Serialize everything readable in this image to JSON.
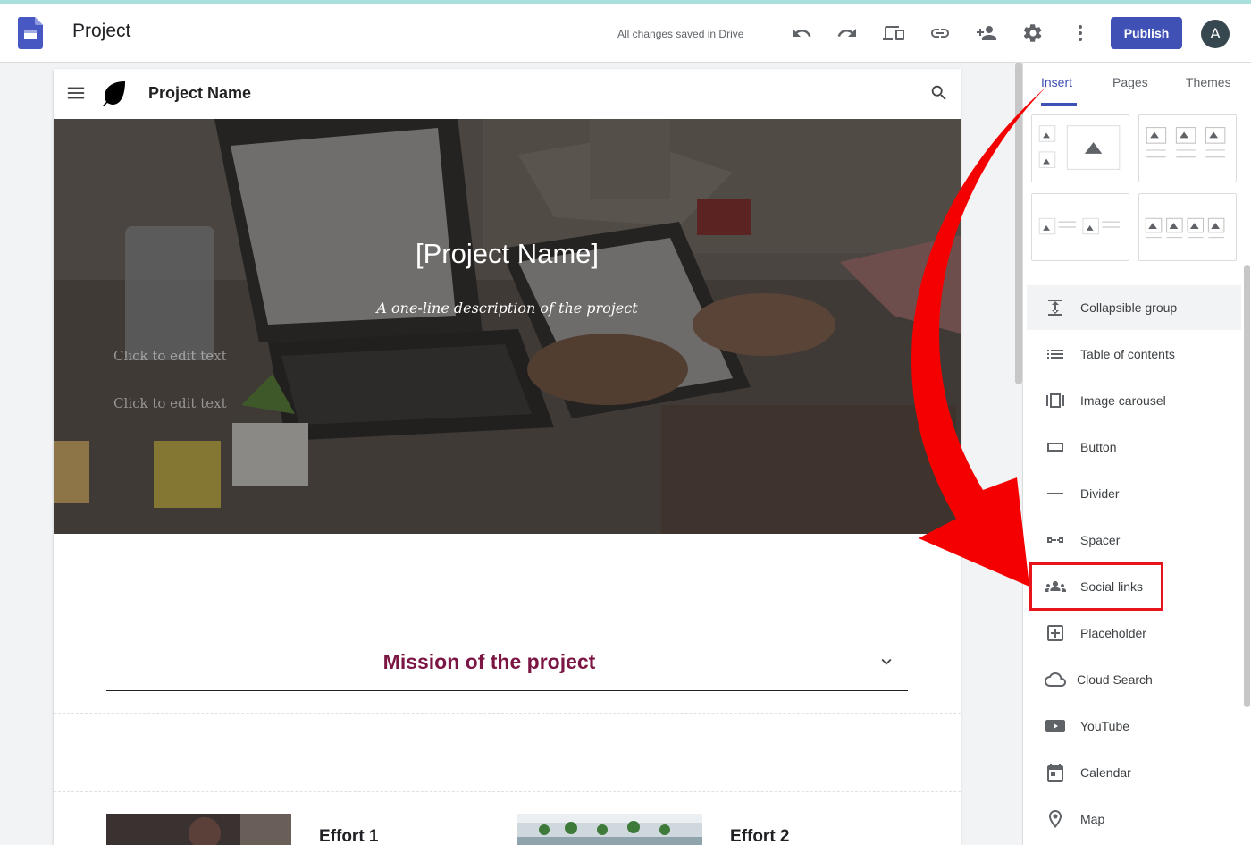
{
  "topbar": {
    "title": "Project",
    "save_status": "All changes saved in Drive",
    "publish_label": "Publish",
    "avatar_letter": "A",
    "icons": [
      "undo-icon",
      "redo-icon",
      "preview-devices-icon",
      "link-icon",
      "add-person-icon",
      "settings-icon",
      "more-vert-icon"
    ]
  },
  "site": {
    "name": "Project Name",
    "hero_title": "[Project Name]",
    "hero_description": "A one-line description of the project",
    "edit_placeholder_1": "Click to edit text",
    "edit_placeholder_2": "Click to edit text",
    "mission_title": "Mission of the project",
    "efforts": [
      {
        "title": "Effort 1"
      },
      {
        "title": "Effort 2"
      }
    ]
  },
  "panel": {
    "tabs": [
      {
        "label": "Insert",
        "active": true
      },
      {
        "label": "Pages",
        "active": false
      },
      {
        "label": "Themes",
        "active": false
      }
    ],
    "items": [
      {
        "label": "Collapsible group",
        "icon": "collapsible-group-icon"
      },
      {
        "label": "Table of contents",
        "icon": "toc-icon"
      },
      {
        "label": "Image carousel",
        "icon": "carousel-icon"
      },
      {
        "label": "Button",
        "icon": "button-icon"
      },
      {
        "label": "Divider",
        "icon": "divider-icon"
      },
      {
        "label": "Spacer",
        "icon": "spacer-icon"
      },
      {
        "label": "Social links",
        "icon": "social-links-icon",
        "highlighted": true
      },
      {
        "label": "Placeholder",
        "icon": "placeholder-icon"
      },
      {
        "label": "Cloud Search",
        "icon": "cloud-search-icon"
      },
      {
        "label": "YouTube",
        "icon": "youtube-icon"
      },
      {
        "label": "Calendar",
        "icon": "calendar-icon"
      },
      {
        "label": "Map",
        "icon": "map-pin-icon"
      }
    ]
  },
  "colors": {
    "accent": "#3f51b5",
    "mission": "#7b1543",
    "annotation": "#e8141c"
  }
}
